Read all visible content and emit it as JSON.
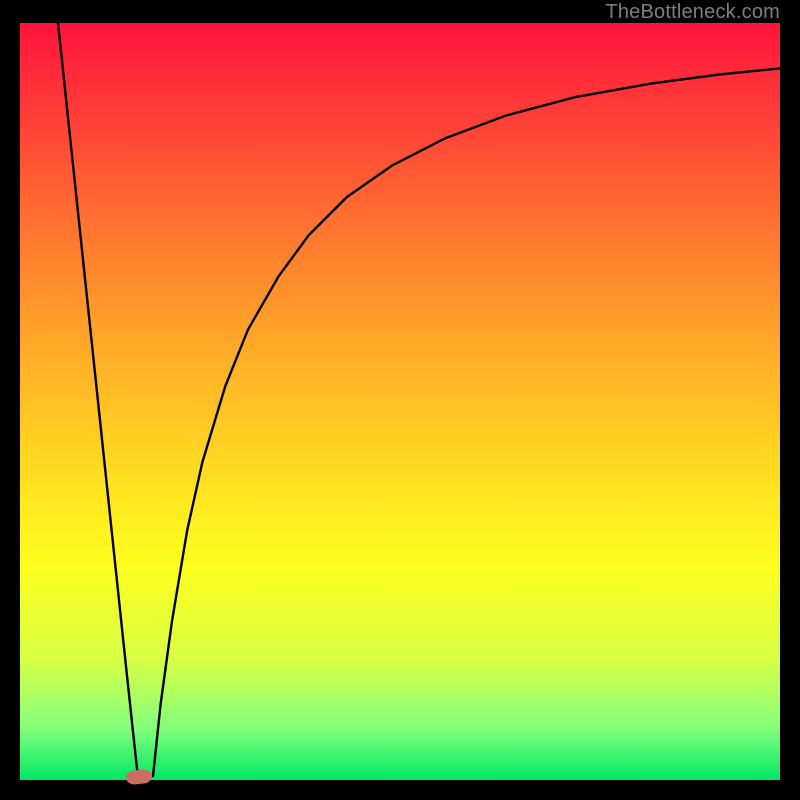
{
  "watermark": "TheBottleneck.com",
  "chart_data": {
    "type": "line",
    "title": "",
    "xlabel": "",
    "ylabel": "",
    "xlim": [
      0,
      100
    ],
    "ylim": [
      0,
      100
    ],
    "grid": false,
    "legend": false,
    "background": "heat-gradient red→yellow→green (top→bottom)",
    "marker": {
      "x_pct": 15.7,
      "y_pct": 0,
      "shape": "blob"
    },
    "series": [
      {
        "name": "left-branch",
        "x": [
          5.0,
          6.0,
          7.0,
          8.0,
          9.0,
          10.0,
          11.0,
          12.0,
          13.0,
          14.0,
          15.5
        ],
        "y": [
          100,
          90.5,
          81.0,
          71.5,
          62.0,
          52.5,
          43.0,
          33.5,
          24.0,
          14.5,
          0.5
        ]
      },
      {
        "name": "right-branch",
        "x": [
          17.5,
          18.5,
          20.0,
          22.0,
          24.0,
          27.0,
          30.0,
          34.0,
          38.0,
          43.0,
          49.0,
          56.0,
          64.0,
          73.0,
          83.0,
          92.0,
          100.0
        ],
        "y": [
          0.5,
          10.0,
          21.0,
          33.0,
          42.0,
          52.0,
          59.5,
          66.5,
          72.0,
          77.0,
          81.2,
          84.8,
          87.8,
          90.2,
          92.0,
          93.2,
          94.0
        ]
      }
    ]
  }
}
